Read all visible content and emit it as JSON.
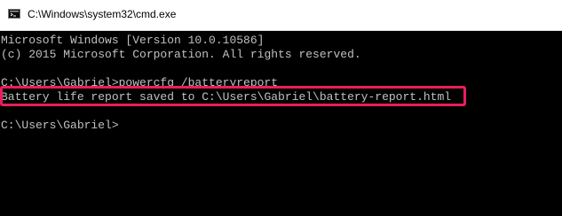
{
  "window": {
    "title": "C:\\Windows\\system32\\cmd.exe",
    "icon": "console-icon"
  },
  "console": {
    "lines": [
      "Microsoft Windows [Version 10.0.10586]",
      "(c) 2015 Microsoft Corporation. All rights reserved.",
      "C:\\Users\\Gabriel>powercfg /batteryreport",
      "Battery life report saved to C:\\Users\\Gabriel\\battery-report.html",
      "C:\\Users\\Gabriel>"
    ]
  },
  "colors": {
    "background": "#000000",
    "text": "#c0c0c0",
    "highlight": "#ec1c5c"
  }
}
